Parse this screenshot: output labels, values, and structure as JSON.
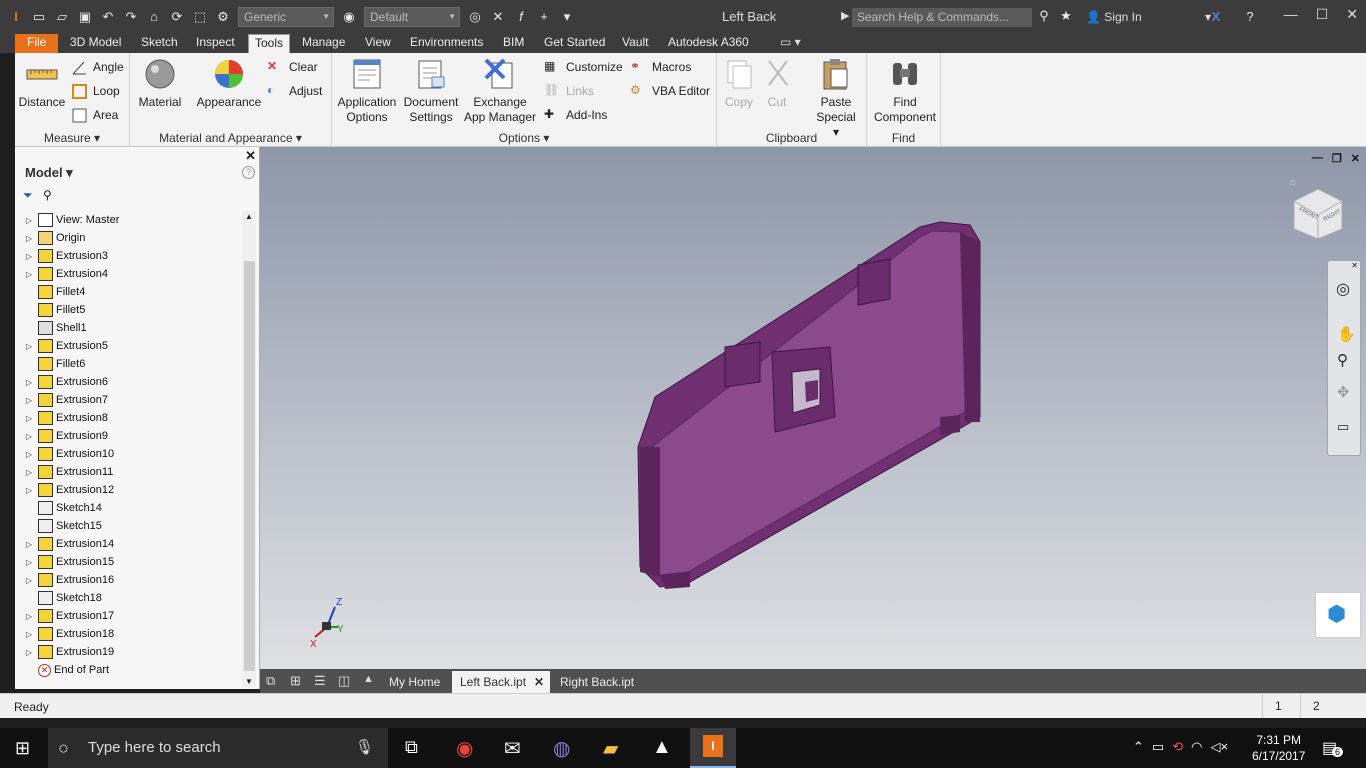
{
  "app": {
    "title": "Left Back",
    "qat_material": "Generic",
    "qat_appearance": "Default",
    "search_placeholder": "Search Help & Commands...",
    "sign_in": "Sign In"
  },
  "tabs": [
    "File",
    "3D Model",
    "Sketch",
    "Inspect",
    "Tools",
    "Manage",
    "View",
    "Environments",
    "BIM",
    "Get Started",
    "Vault",
    "Autodesk A360"
  ],
  "active_tab": "Tools",
  "ribbon": {
    "measure": {
      "label": "Measure",
      "distance": "Distance",
      "angle": "Angle",
      "loop": "Loop",
      "area": "Area"
    },
    "material": {
      "label": "Material and Appearance",
      "material": "Material",
      "appearance": "Appearance",
      "clear": "Clear",
      "adjust": "Adjust"
    },
    "options": {
      "label": "Options",
      "app_options_1": "Application",
      "app_options_2": "Options",
      "doc_settings_1": "Document",
      "doc_settings_2": "Settings",
      "exchange_1": "Exchange",
      "exchange_2": "App Manager",
      "customize": "Customize",
      "links": "Links",
      "addins": "Add-Ins",
      "macros": "Macros",
      "vba": "VBA Editor"
    },
    "clipboard": {
      "label": "Clipboard",
      "copy": "Copy",
      "cut": "Cut",
      "paste_1": "Paste",
      "paste_2": "Special"
    },
    "find": {
      "label": "Find",
      "find_1": "Find",
      "find_2": "Component"
    }
  },
  "browser": {
    "title": "Model",
    "nodes": [
      {
        "label": "View: Master",
        "expand": true,
        "icon": "view"
      },
      {
        "label": "Origin",
        "expand": true,
        "icon": "folder"
      },
      {
        "label": "Extrusion3",
        "expand": true,
        "icon": "extrude"
      },
      {
        "label": "Extrusion4",
        "expand": true,
        "icon": "extrude"
      },
      {
        "label": "Fillet4",
        "expand": false,
        "icon": "fillet"
      },
      {
        "label": "Fillet5",
        "expand": false,
        "icon": "fillet"
      },
      {
        "label": "Shell1",
        "expand": false,
        "icon": "shell"
      },
      {
        "label": "Extrusion5",
        "expand": true,
        "icon": "extrude"
      },
      {
        "label": "Fillet6",
        "expand": false,
        "icon": "fillet"
      },
      {
        "label": "Extrusion6",
        "expand": true,
        "icon": "extrude"
      },
      {
        "label": "Extrusion7",
        "expand": true,
        "icon": "extrude"
      },
      {
        "label": "Extrusion8",
        "expand": true,
        "icon": "extrude"
      },
      {
        "label": "Extrusion9",
        "expand": true,
        "icon": "extrude"
      },
      {
        "label": "Extrusion10",
        "expand": true,
        "icon": "extrude"
      },
      {
        "label": "Extrusion11",
        "expand": true,
        "icon": "extrude"
      },
      {
        "label": "Extrusion12",
        "expand": true,
        "icon": "extrude"
      },
      {
        "label": "Sketch14",
        "expand": false,
        "icon": "sketch"
      },
      {
        "label": "Sketch15",
        "expand": false,
        "icon": "sketch"
      },
      {
        "label": "Extrusion14",
        "expand": true,
        "icon": "extrude"
      },
      {
        "label": "Extrusion15",
        "expand": true,
        "icon": "extrude"
      },
      {
        "label": "Extrusion16",
        "expand": true,
        "icon": "extrude"
      },
      {
        "label": "Sketch18",
        "expand": false,
        "icon": "sketch"
      },
      {
        "label": "Extrusion17",
        "expand": true,
        "icon": "extrude"
      },
      {
        "label": "Extrusion18",
        "expand": true,
        "icon": "extrude"
      },
      {
        "label": "Extrusion19",
        "expand": true,
        "icon": "extrude"
      },
      {
        "label": "End of Part",
        "expand": false,
        "icon": "end"
      }
    ]
  },
  "viewport": {
    "triad": {
      "x": "X",
      "y": "Y",
      "z": "Z"
    },
    "viewcube_faces": {
      "front": "FRONT",
      "right": "RIGHT"
    },
    "part_color": "#7b3a7c"
  },
  "doc_tabs": [
    "My Home",
    "Left Back.ipt",
    "Right Back.ipt"
  ],
  "active_doc": "Left Back.ipt",
  "status": {
    "text": "Ready",
    "n1": "1",
    "n2": "2"
  },
  "taskbar": {
    "search": "Type here to search",
    "time": "7:31 PM",
    "date": "6/17/2017",
    "notif_count": "6"
  }
}
